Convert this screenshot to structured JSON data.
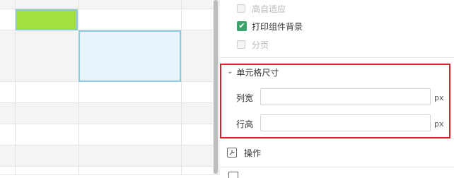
{
  "panel": {
    "checkboxes": [
      {
        "label": "高自适应",
        "checked": false,
        "disabled": true
      },
      {
        "label": "打印组件背景",
        "checked": true,
        "disabled": false
      },
      {
        "label": "分页",
        "checked": false,
        "disabled": true
      }
    ],
    "check_mark": "✔",
    "cell_size": {
      "title": "单元格尺寸",
      "chevron": "⌄",
      "width_label": "列宽",
      "width_value": "",
      "height_label": "行高",
      "height_value": "",
      "unit": "px"
    },
    "operations_label": "操作",
    "operations_icon": "wrench-icon"
  },
  "colors": {
    "highlight_border": "#d9232c",
    "checked_green": "#3aa56a",
    "cell_green": "#a3e03f",
    "cell_selected": "#e8f3fb"
  }
}
